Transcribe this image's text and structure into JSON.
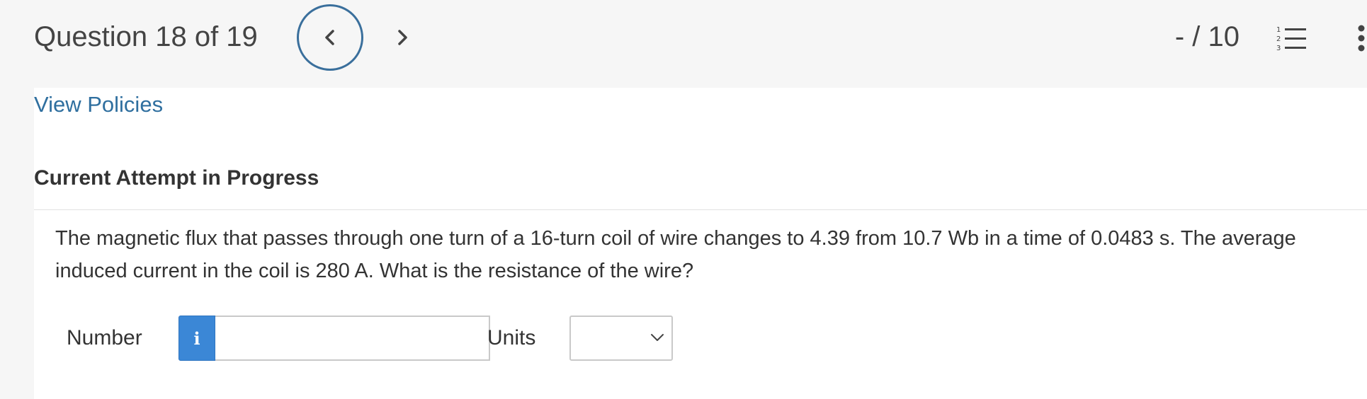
{
  "header": {
    "question_position": "Question 18 of 19",
    "score": "- / 10",
    "prev_icon": "chevron-left-icon",
    "next_icon": "chevron-right-icon",
    "list_icon": "numbered-list-icon",
    "more_icon": "more-vertical-icon"
  },
  "links": {
    "view_policies": "View Policies"
  },
  "section": {
    "title": "Current Attempt in Progress"
  },
  "question": {
    "text": "The magnetic flux that passes through one turn of a 16-turn coil of wire changes to 4.39 from 10.7 Wb in a time of 0.0483 s. The average induced current in the coil is 280 A. What is the resistance of the wire?"
  },
  "answer": {
    "number_label": "Number",
    "info_glyph": "i",
    "number_value": "",
    "units_label": "Units",
    "units_selected": ""
  },
  "colors": {
    "accent": "#2f6f9f",
    "info_button": "#3b87d6",
    "header_bg": "#f6f6f6"
  }
}
